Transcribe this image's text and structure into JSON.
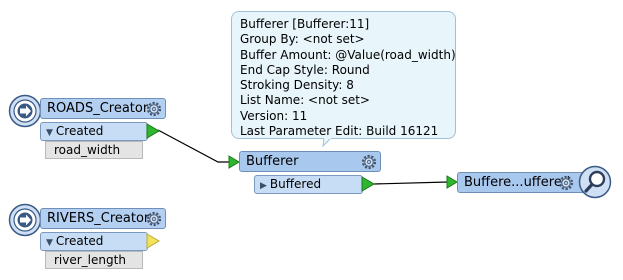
{
  "tooltip": {
    "lines": [
      "Bufferer [Bufferer:11]",
      "Group By: <not set>",
      "Buffer Amount: @Value(road_width)",
      "End Cap Style: Round",
      "Stroking Density: 8",
      "List Name: <not set>",
      "Version: 11",
      "Last Parameter Edit: Build 16121"
    ]
  },
  "roads_creator": {
    "title": "ROADS_Creator",
    "output_port": "Created",
    "attribute": "road_width"
  },
  "rivers_creator": {
    "title": "RIVERS_Creator",
    "output_port": "Created",
    "attribute": "river_length"
  },
  "bufferer": {
    "title": "Bufferer",
    "output_port": "Buffered"
  },
  "inspector": {
    "title": "Buffere...uffered"
  },
  "colors": {
    "port_connected": "#2fb62f",
    "port_unconnected": "#f2e35a",
    "node_header": "#a9c8ee",
    "tooltip_bg": "#e8f5fb"
  },
  "icons": {
    "creator": "creator-circle-arrow-icon",
    "gear": "gear-icon",
    "inspector": "magnifier-icon"
  }
}
